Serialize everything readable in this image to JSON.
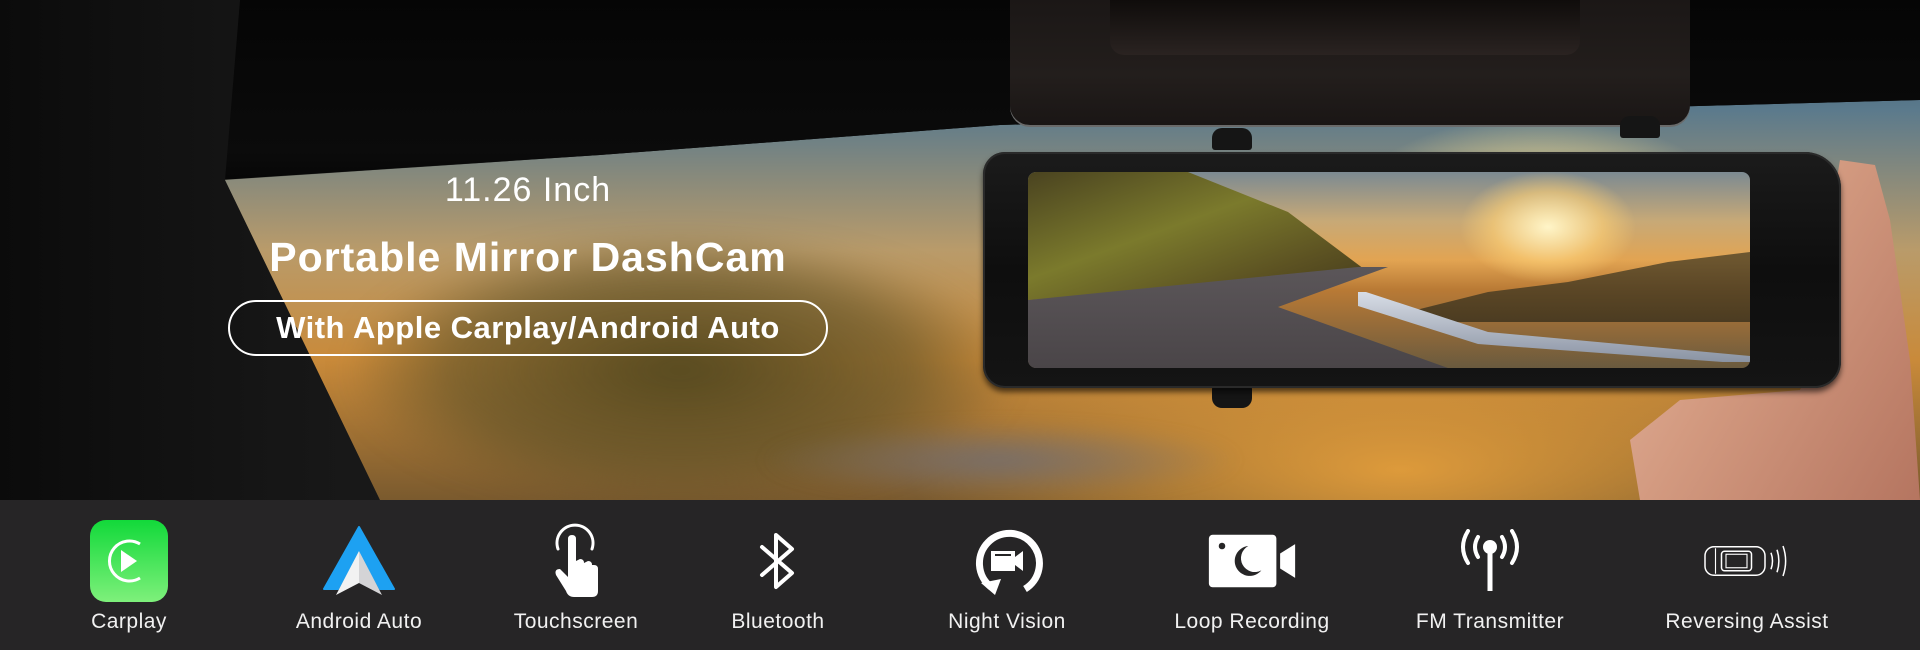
{
  "hero": {
    "size_text": "11.26 Inch",
    "title": "Portable Mirror DashCam",
    "subtitle_pill": "With Apple Carplay/Android Auto"
  },
  "product": {
    "name": "mirror-dashcam",
    "screen_scene": "mountain-road-sunset"
  },
  "colors": {
    "feature_bar_bg": "#262526",
    "carplay_green_top": "#12d93a",
    "carplay_green_bottom": "#7ef07b",
    "android_blue": "#1da1f2",
    "text_white": "#ffffff"
  },
  "features": [
    {
      "label": "Carplay",
      "icon": "carplay-icon"
    },
    {
      "label": "Android Auto",
      "icon": "android-auto-icon"
    },
    {
      "label": "Touchscreen",
      "icon": "touch-hand-icon"
    },
    {
      "label": "Bluetooth",
      "icon": "bluetooth-icon"
    },
    {
      "label": "Night Vision",
      "icon": "loop-camera-icon"
    },
    {
      "label": "Loop Recording",
      "icon": "night-camera-icon"
    },
    {
      "label": "FM Transmitter",
      "icon": "antenna-icon"
    },
    {
      "label": "Reversing Assist",
      "icon": "car-sensor-icon"
    }
  ]
}
